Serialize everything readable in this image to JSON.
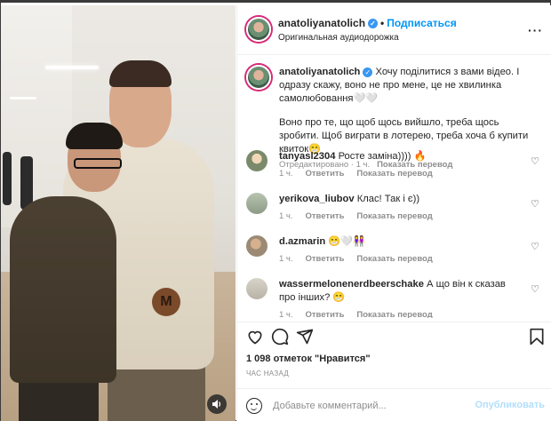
{
  "post": {
    "username": "anatoliyanatolich",
    "separator": "•",
    "follow_label": "Подписаться",
    "audio_label": "Оригинальная аудиодорожка",
    "more_label": "···",
    "verified_glyph": "✓"
  },
  "caption": {
    "username": "anatoliyanatolich",
    "text_1": "Хочу поділитися з вами відео. І одразу скажу, воно не про мене, це не хвилинка самолюбовання🤍🤍",
    "text_2": "Воно про те, що щоб щось вийшло, треба щось зробити. Щоб виграти в лотерею, треба хоча б купити квиток😁",
    "edited": "Отредактировано",
    "time": "1 ч.",
    "translate": "Показать перевод"
  },
  "comments": [
    {
      "username": "tanyasl2304",
      "text": "Росте заміна)))) 🔥",
      "time": "1 ч.",
      "reply": "Ответить",
      "translate": "Показать перевод",
      "avatar_color": "#7a8a6a"
    },
    {
      "username": "yerikova_liubov",
      "text": "Клас! Так і є))",
      "time": "1 ч.",
      "reply": "Ответить",
      "translate": "Показать перевод",
      "avatar_color": "#8d9b86"
    },
    {
      "username": "d.azmarin",
      "text": "😁🤍👭",
      "time": "1 ч.",
      "reply": "Ответить",
      "translate": "Показать перевод",
      "avatar_color": "#9c8a74"
    },
    {
      "username": "wassermelonenerdbeerschake",
      "text": "А що він к сказав про інших? 😁",
      "time": "1 ч.",
      "reply": "Ответить",
      "translate": "Показать перевод",
      "avatar_color": "#b8b3a6"
    }
  ],
  "actions": {
    "like_icon": "heart-icon",
    "comment_icon": "comment-icon",
    "share_icon": "share-icon",
    "save_icon": "bookmark-icon"
  },
  "likes": "1 098 отметок \"Нравится\"",
  "timestamp": "ЧАС НАЗАД",
  "add_comment": {
    "placeholder": "Добавьте комментарий...",
    "publish_label": "Опубликовать"
  },
  "colors": {
    "accent": "#0095f6",
    "muted": "#8e8e8e",
    "publish_disabled": "#b2dffc"
  }
}
